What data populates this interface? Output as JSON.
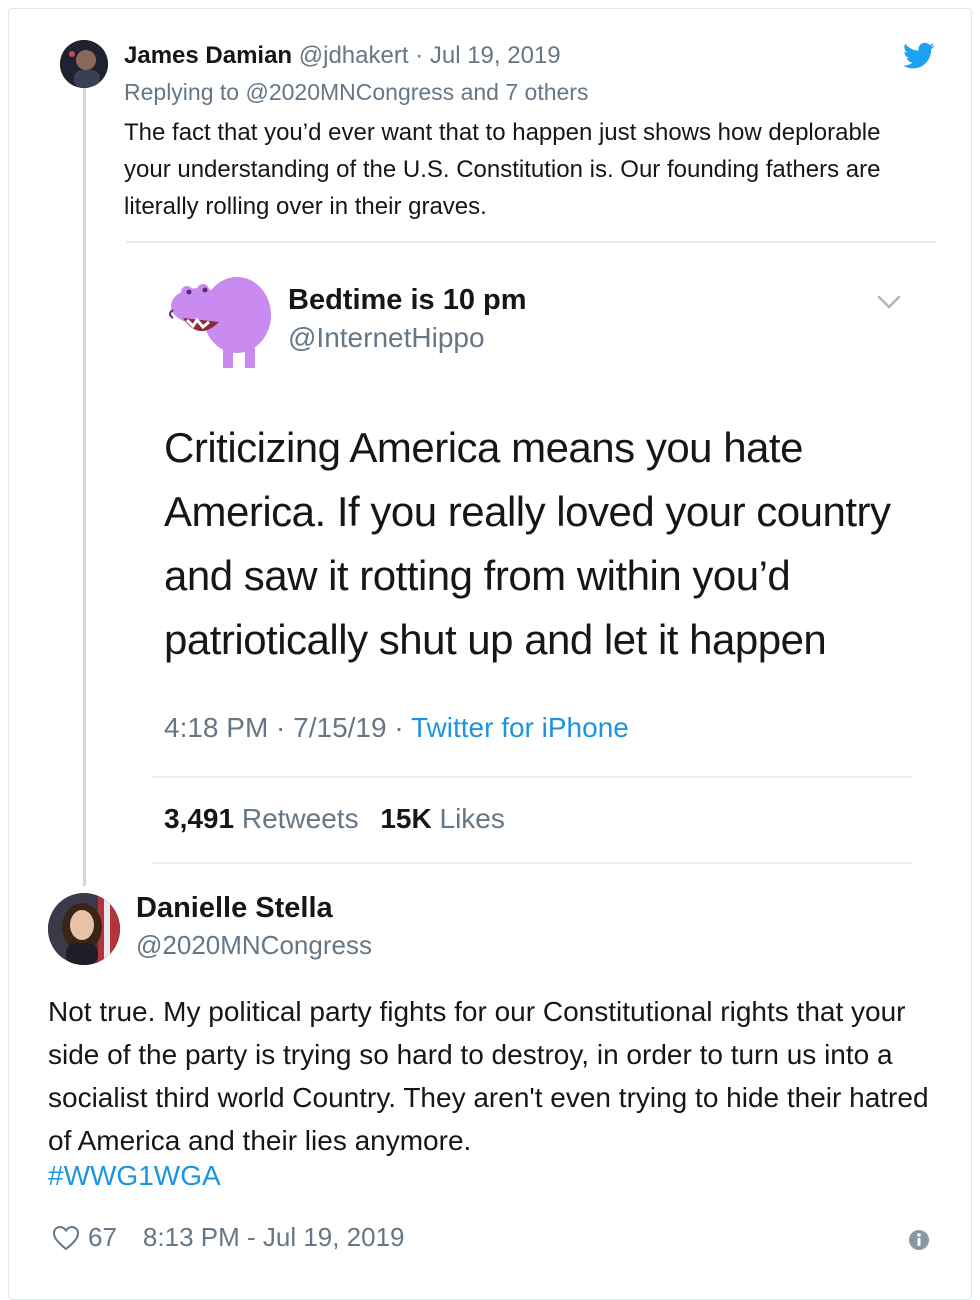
{
  "reply": {
    "author_name": "James Damian",
    "author_handle": "@jdhakert",
    "separator": "·",
    "date": "Jul 19, 2019",
    "replying_prefix": "Replying to",
    "replying_target": "@2020MNCongress",
    "replying_suffix": "and 7 others",
    "text": "The fact that you’d ever want that to happen just shows how deplorable your understanding of the U.S. Constitution is. Our founding fathers are literally rolling over in their graves."
  },
  "quoted": {
    "author_name": "Bedtime is 10 pm",
    "author_handle": "@InternetHippo",
    "text": "Criticizing America means you hate America. If you really loved your country and saw it rotting from within you’d patriotically shut up and let it happen",
    "time": "4:18 PM · 7/15/19 · ",
    "source": "Twitter for iPhone",
    "retweets_count": "3,491",
    "retweets_label": "Retweets",
    "likes_count": "15K",
    "likes_label": "Likes"
  },
  "original": {
    "author_name": "Danielle Stella",
    "author_handle": "@2020MNCongress",
    "text": "Not true. My political party fights for our Constitutional rights that your side of the party is trying so hard to destroy, in order to turn us into a socialist third world Country. They aren't even trying to hide their hatred of America and their lies anymore.",
    "hashtag": "#WWG1WGA",
    "likes": "67",
    "timestamp": "8:13 PM - Jul 19, 2019"
  },
  "colors": {
    "twitter_blue": "#1da1f2",
    "link_blue": "#1b95e0",
    "secondary_text": "#657786",
    "hippo_purple": "#c98bf0"
  },
  "icons": [
    "twitter-bird-icon",
    "chevron-down-icon",
    "heart-icon",
    "info-icon"
  ]
}
